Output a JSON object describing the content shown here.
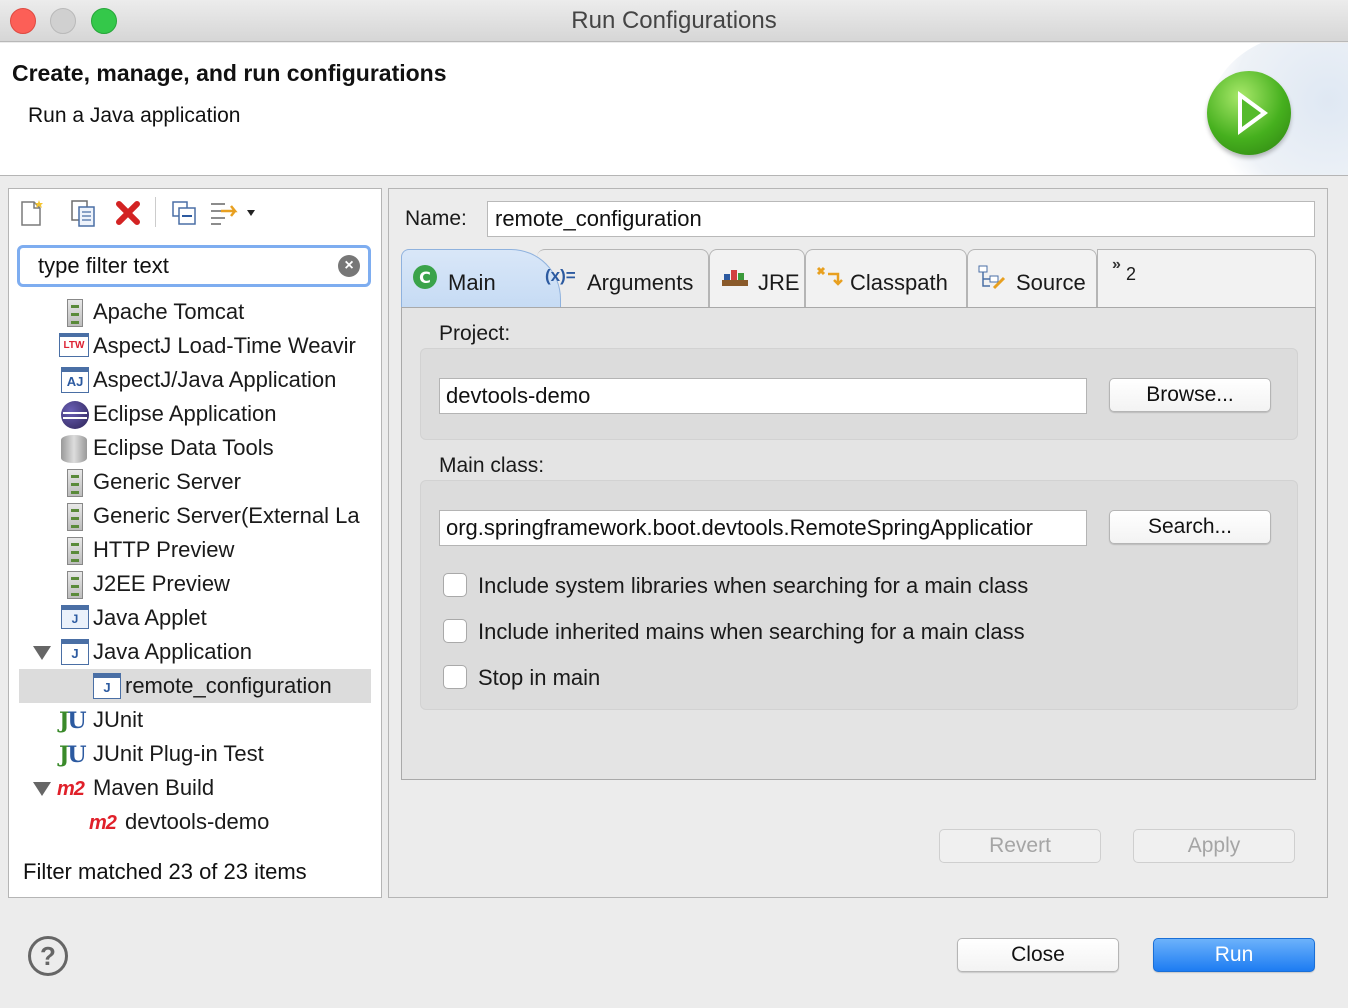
{
  "window": {
    "title": "Run Configurations"
  },
  "banner": {
    "title": "Create, manage, and run configurations",
    "subtitle": "Run a Java application"
  },
  "toolbar": {
    "icons": [
      "new-config-icon",
      "duplicate-icon",
      "delete-icon",
      "collapse-all-icon",
      "filter-menu-icon"
    ]
  },
  "filter": {
    "placeholder": "type filter text",
    "value": "type filter text"
  },
  "tree": {
    "items": [
      {
        "label": "Apache Tomcat",
        "icon": "server-icon",
        "level": 1
      },
      {
        "label": "AspectJ Load-Time Weavir",
        "icon": "aspectj-ltw-icon",
        "level": 1
      },
      {
        "label": "AspectJ/Java Application",
        "icon": "aspectj-app-icon",
        "level": 1
      },
      {
        "label": "Eclipse Application",
        "icon": "eclipse-icon",
        "level": 1
      },
      {
        "label": "Eclipse Data Tools",
        "icon": "database-icon",
        "level": 1
      },
      {
        "label": "Generic Server",
        "icon": "server-icon",
        "level": 1
      },
      {
        "label": "Generic Server(External La",
        "icon": "server-icon",
        "level": 1
      },
      {
        "label": "HTTP Preview",
        "icon": "server-icon",
        "level": 1
      },
      {
        "label": "J2EE Preview",
        "icon": "server-icon",
        "level": 1
      },
      {
        "label": "Java Applet",
        "icon": "java-applet-icon",
        "level": 1
      },
      {
        "label": "Java Application",
        "icon": "java-app-icon",
        "level": 1,
        "expanded": true
      },
      {
        "label": "remote_configuration",
        "icon": "java-app-icon",
        "level": 2,
        "selected": true
      },
      {
        "label": "JUnit",
        "icon": "junit-icon",
        "level": 1
      },
      {
        "label": "JUnit Plug-in Test",
        "icon": "junit-plugin-icon",
        "level": 1
      },
      {
        "label": "Maven Build",
        "icon": "maven-icon",
        "level": 1,
        "expanded": true
      },
      {
        "label": "devtools-demo",
        "icon": "maven-icon",
        "level": 2
      }
    ],
    "status": "Filter matched 23 of 23 items"
  },
  "config": {
    "name_label": "Name:",
    "name_value": "remote_configuration",
    "tabs": [
      {
        "label": "Main",
        "icon": "main-tab-icon",
        "active": true
      },
      {
        "label": "Arguments",
        "icon": "arguments-icon"
      },
      {
        "label": "JRE",
        "icon": "jre-icon"
      },
      {
        "label": "Classpath",
        "icon": "classpath-icon"
      },
      {
        "label": "Source",
        "icon": "source-icon"
      },
      {
        "label": "2",
        "icon": "overflow-chevron-icon"
      }
    ],
    "project_label": "Project:",
    "project_value": "devtools-demo",
    "browse_label": "Browse...",
    "main_class_label": "Main class:",
    "main_class_value": "org.springframework.boot.devtools.RemoteSpringApplicatior",
    "search_label": "Search...",
    "options": [
      {
        "label": "Include system libraries when searching for a main class",
        "checked": false
      },
      {
        "label": "Include inherited mains when searching for a main class",
        "checked": false
      },
      {
        "label": "Stop in main",
        "checked": false
      }
    ],
    "revert_label": "Revert",
    "apply_label": "Apply"
  },
  "footer": {
    "help": "?",
    "close_label": "Close",
    "run_label": "Run"
  }
}
